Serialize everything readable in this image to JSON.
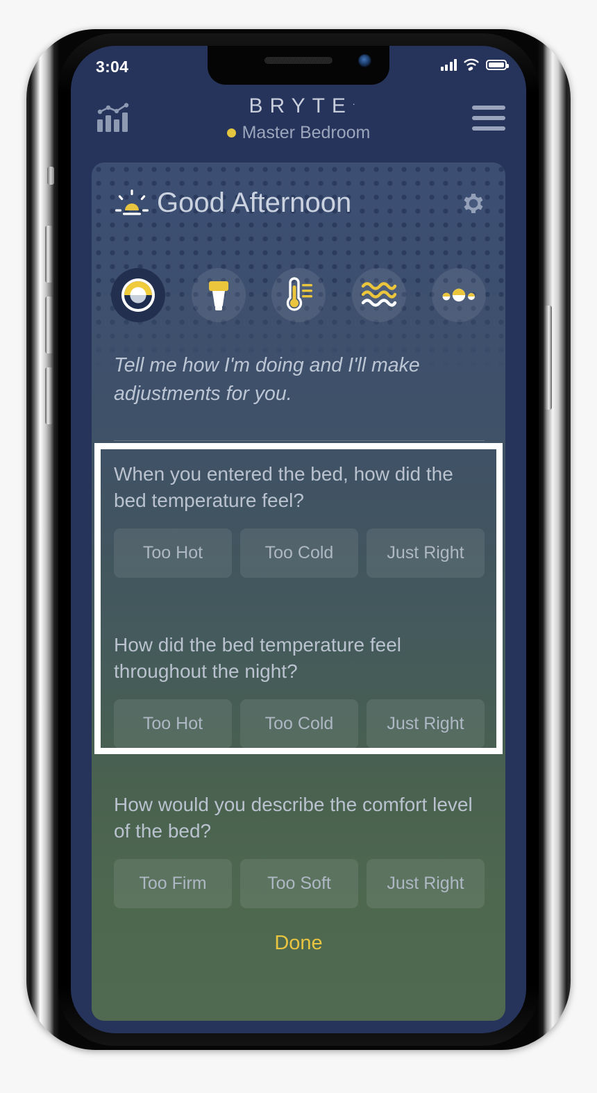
{
  "status_bar": {
    "time": "3:04",
    "signal_icon": "cellular-signal-icon",
    "wifi_icon": "wifi-icon",
    "battery_icon": "battery-icon"
  },
  "header": {
    "stats_icon": "bar-chart-icon",
    "menu_icon": "hamburger-menu-icon",
    "brand": "BRYTE",
    "brand_tm": ".",
    "room_name": "Master Bedroom",
    "room_status_color": "#e3c53f"
  },
  "card": {
    "greeting": "Good Afternoon",
    "greeting_icon": "sunrise-icon",
    "settings_icon": "gear-icon",
    "quick_icons": [
      {
        "name": "bryte-logo-icon",
        "active": true
      },
      {
        "name": "light-bulb-icon",
        "active": false
      },
      {
        "name": "thermometer-icon",
        "active": false
      },
      {
        "name": "waves-icon",
        "active": false
      },
      {
        "name": "more-dots-icon",
        "active": false
      }
    ],
    "assistant_message": "Tell me how I'm doing and I'll make adjustments for you.",
    "accent_color": "#e8c440"
  },
  "questions": [
    {
      "text": "When you entered the bed, how did the bed temperature feel?",
      "options": [
        "Too Hot",
        "Too Cold",
        "Just Right"
      ]
    },
    {
      "text": "How did the bed temperature feel throughout the night?",
      "options": [
        "Too Hot",
        "Too Cold",
        "Just Right"
      ]
    },
    {
      "text": "How would you describe the comfort level of the bed?",
      "options": [
        "Too Firm",
        "Too Soft",
        "Just Right"
      ]
    }
  ],
  "done_label": "Done"
}
